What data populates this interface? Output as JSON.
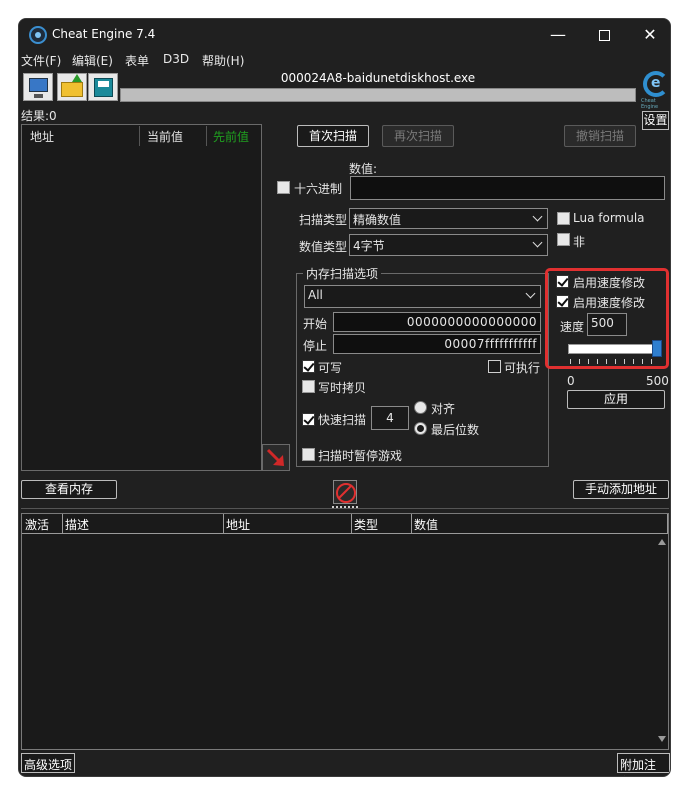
{
  "window": {
    "title": "Cheat Engine 7.4",
    "minimize": "—",
    "close": "✕"
  },
  "menu": [
    "文件(F)",
    "编辑(E)",
    "表单",
    "D3D",
    "帮助(H)"
  ],
  "toolbar": {
    "process": "000024A8-baidunetdiskhost.exe",
    "settings_label": "设置",
    "logo_sub": "Cheat Engine"
  },
  "results": {
    "label": "结果:0"
  },
  "found_list": {
    "columns": [
      "地址",
      "当前值",
      "先前值"
    ],
    "prev_color": "#20a020"
  },
  "scan": {
    "first_scan": "首次扫描",
    "next_scan": "再次扫描",
    "undo_scan": "撤销扫描",
    "value_label": "数值:",
    "hex_label": "十六进制",
    "value": "",
    "scan_type_label": "扫描类型",
    "scan_type": "精确数值",
    "value_type_label": "数值类型",
    "value_type": "4字节",
    "lua_formula": "Lua formula",
    "not_label": "非"
  },
  "memory_options": {
    "title": "内存扫描选项",
    "region": "All",
    "start_label": "开始",
    "start": "0000000000000000",
    "stop_label": "停止",
    "stop": "00007fffffffffff",
    "writable": "可写",
    "executable": "可执行",
    "copy_on_write": "写时拷贝",
    "fast_scan": "快速扫描",
    "fast_scan_value": "4",
    "align": "对齐",
    "last_digits": "最后位数",
    "pause_game": "扫描时暂停游戏"
  },
  "speedhack": {
    "enable1": "启用速度修改",
    "enable2": "启用速度修改",
    "speed_label": "速度",
    "speed": "500",
    "slider_level": 1.0,
    "min": "0",
    "max": "500",
    "apply": "应用",
    "highlight_color": "#e03030"
  },
  "actions": {
    "view_memory": "查看内存",
    "add_address": "手动添加地址"
  },
  "address_list": {
    "columns": [
      "激活",
      "描述",
      "地址",
      "类型",
      "数值"
    ]
  },
  "bottom": {
    "advanced": "高级选项",
    "comments": "附加注释"
  }
}
